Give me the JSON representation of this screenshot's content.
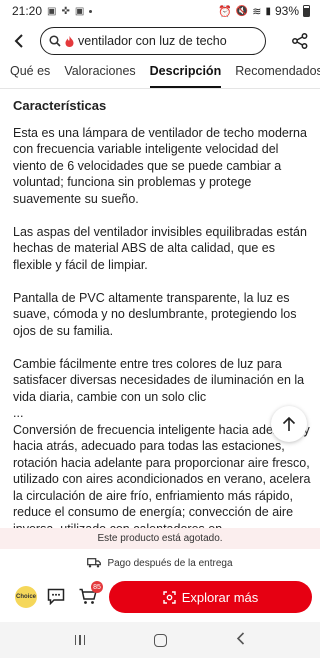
{
  "status_bar": {
    "time": "21:20",
    "battery": "93%"
  },
  "search": {
    "query": "ventilador con luz de techo"
  },
  "tabs": [
    {
      "label": "Qué es"
    },
    {
      "label": "Valoraciones"
    },
    {
      "label": "Descripción"
    },
    {
      "label": "Recomendados"
    }
  ],
  "description": {
    "heading": "Características",
    "p1": "Esta es una lámpara de ventilador de techo moderna con frecuencia variable inteligente velocidad del viento de 6 velocidades que se puede cambiar a voluntad; funciona sin problemas y protege suavemente su sueño.",
    "p2": "Las aspas del ventilador invisibles equilibradas están hechas de material ABS de alta calidad, que es flexible y fácil de limpiar.",
    "p3": "Pantalla de PVC altamente transparente, la luz es suave, cómoda y no deslumbrante, protegiendo los ojos de su familia.",
    "p4": "Cambie fácilmente entre tres colores de luz para satisfacer diversas necesidades de iluminación en la vida diaria, cambie con un solo clic",
    "ellipsis": "...",
    "p5": "Conversión de frecuencia inteligente hacia adelante y hacia atrás, adecuado para todas las estaciones, rotación hacia adelante para proporcionar aire fresco, utilizado con aires acondicionados en verano, acelera la circulación de aire frío, enfriamiento más rápido, reduce el consumo de energía; convección de aire inversa, utilizado con calentadores en"
  },
  "soldout_text": "Este producto está agotado.",
  "delivery_text": "Pago después de la entrega",
  "bottom": {
    "choice_label": "Choice",
    "cart_count": "85",
    "explore_label": "Explorar más"
  }
}
